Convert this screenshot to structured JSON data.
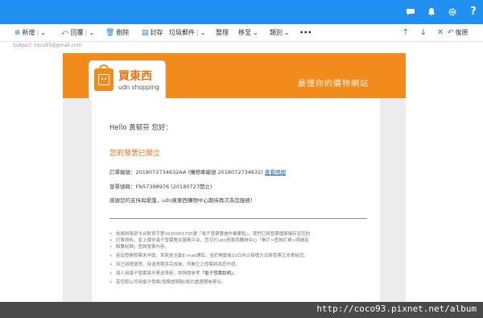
{
  "topbar": {
    "icons": [
      "chat-icon",
      "bell-icon",
      "gear-icon",
      "help-icon"
    ],
    "accent": "#1f8ff0"
  },
  "toolbar": {
    "new_label": "新增",
    "reply_label": "回覆",
    "delete_label": "刪除",
    "archive_label": "封存",
    "junk_label": "垃圾郵件",
    "sweep_label": "整理",
    "move_label": "移至",
    "category_label": "類別",
    "more_label": "•••",
    "undo_label": "復原"
  },
  "email": {
    "address_line": "Subject: coco93@gmail.com",
    "brand_cn": "買東西",
    "brand_en": "udn shopping",
    "slogan": "最懂你的購物網站",
    "greeting": "Hello 黃郁芬 您好：",
    "heading": "您的發票已開立",
    "order_prefix": "訂單編號：2018072734632AA (購物車編號 2018072734632)",
    "order_link": "查看明細",
    "invoice_line": "發票號碼：FN57398976 (20180727開立)",
    "thanks_line": "感謝您的支持與愛護，udn買東西購物中心期待再次為您服務！",
    "notes": [
      {
        "text": "依據財政部令台財資字第1020002795號「電子發票實施作業要點」，我們已將發票檔案儲存至您的",
        "hl": ""
      },
      {
        "text": "訂單資料，並上傳至電子發票整合服務平台，您可於udn買東西購物中心「帳戶>查詢訂單>明細及",
        "hl": ""
      },
      {
        "text": "聯繫紀錄」查詢發票內容。",
        "hl": ""
      },
      {
        "text": "若延發開發票未中獎，系統會主動E-mail通知，並於開獎後10日內以掛號方式將發票正本寄給您。",
        "hl": ""
      },
      {
        "text": "如已辦理退貨，待退貨程序完成後，所開立之發票將為您作廢。",
        "hl": ""
      },
      {
        "text": "個人用電子發票將不寄送表紙，詳情請參考",
        "hl": "「電子發票說明」。"
      },
      {
        "text": "若您取公司用電子發票(發票證明聯)將於處理期後寄出。",
        "hl": ""
      }
    ]
  },
  "watermark": "http://coco93.pixnet.net/album",
  "colors": {
    "orange": "#f28a1c",
    "link": "#1a5fb4",
    "blue": "#1f8ff0"
  }
}
